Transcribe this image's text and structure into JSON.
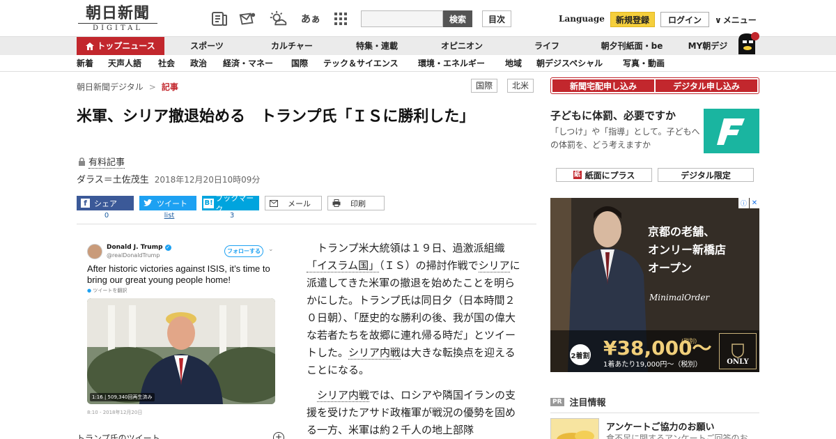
{
  "header": {
    "logo_ja": "朝日新聞",
    "logo_en": "DIGITAL",
    "search_placeholder": "",
    "search_button": "検索",
    "toc_button": "目次",
    "language": "Language",
    "register": "新規登録",
    "login": "ログイン",
    "menu": "メニュー"
  },
  "icons": [
    "paper-icon",
    "mail-icon",
    "weather-icon",
    "font-size-icon",
    "grid-icon"
  ],
  "font_size_glyph": "あぁ",
  "nav1": [
    "トップニュース",
    "スポーツ",
    "カルチャー",
    "特集・連載",
    "オピニオン",
    "ライフ",
    "朝夕刊紙面・be",
    "MY朝デジ"
  ],
  "nav2": [
    "新着",
    "天声人語",
    "社会",
    "政治",
    "経済・マネー",
    "国際",
    "テック＆サイエンス",
    "環境・エネルギー",
    "地域",
    "朝デジスペシャル",
    "写真・動画"
  ],
  "breadcrumb": {
    "home": "朝日新聞デジタル",
    "sep": ">",
    "current": "記事"
  },
  "tags": [
    "国際",
    "北米"
  ],
  "article": {
    "title": "米軍、シリア撤退始める　トランプ氏「ＩＳに勝利した」",
    "paid": "有料記事",
    "author": "ダラス＝土佐茂生",
    "date": "2018年12月20日10時09分",
    "share": {
      "facebook": "シェア",
      "facebook_count": "0",
      "twitter": "ツイート",
      "twitter_count": "list",
      "hatena": "ブックマーク",
      "hatena_count": "3",
      "mail": "メール",
      "print": "印刷"
    },
    "para1_parts": [
      "トランプ米大統領は１９日、過激派組織",
      "「イスラム国」",
      "（ＩＳ）の掃討作戦で",
      "シリア",
      "に派遣してきた米軍の撤退を始めたことを明らかにした。トランプ氏は同日夕（日本時間２０日朝）、「歴史的な勝利の後、我が国の偉大な若者たちを故郷に連れ帰る時だ」とツイートした。",
      "シリア内戦",
      "は大きな転換点を迎えることになる。"
    ],
    "para2_parts": [
      "シリア内戦",
      "では、ロシアや隣国イランの支援を受けたアサド政権軍が戦況の優勢を固める一方、米軍は約２千人の地上部隊"
    ]
  },
  "tweet": {
    "name": "Donald J. Trump",
    "handle": "@realDonaldTrump",
    "follow": "フォローする",
    "text": "After historic victories against ISIS, it’s time to bring our great young people home!",
    "translate": "ツイートを翻訳",
    "video_duration": "1:16",
    "video_views": "509,340回再生済み",
    "timestamp": "8:10 - 2018年12月20日",
    "caption": "トランプ氏のツイート"
  },
  "sidebar": {
    "subscribe_paper": "新聞宅配申し込み",
    "subscribe_digital": "デジタル申し込み",
    "promo_title": "子どもに体罰、必要ですか",
    "promo_desc": "「しつけ」や「指導」として。子どもへの体罰を、どう考えますか",
    "promo_logo_letter": "F",
    "plus_paper": "紙面にプラス",
    "digital_only": "デジタル限定"
  },
  "ad": {
    "copy1": "京都の老舗、",
    "copy2": "オンリー新橋店",
    "copy3": "オープン",
    "brand": "MinimalOrder",
    "badge": "2着割",
    "price": "¥38,000〜",
    "tax": "(税別)",
    "sub": "1着あたり19,000円〜（税別）",
    "logo": "ONLY",
    "info": "ⓘ",
    "close": "✕"
  },
  "pr": {
    "badge": "PR",
    "heading": "注目情報",
    "title": "アンケートご協力のお願い",
    "desc": "食不足に関するアンケートご回答のお"
  },
  "colors": {
    "brand_red": "#c2272d",
    "register_yellow": "#f5cf3c",
    "facebook": "#3b5998",
    "twitter": "#1da1f2",
    "hatena": "#00a4de",
    "promo_teal": "#1ab5a0"
  }
}
